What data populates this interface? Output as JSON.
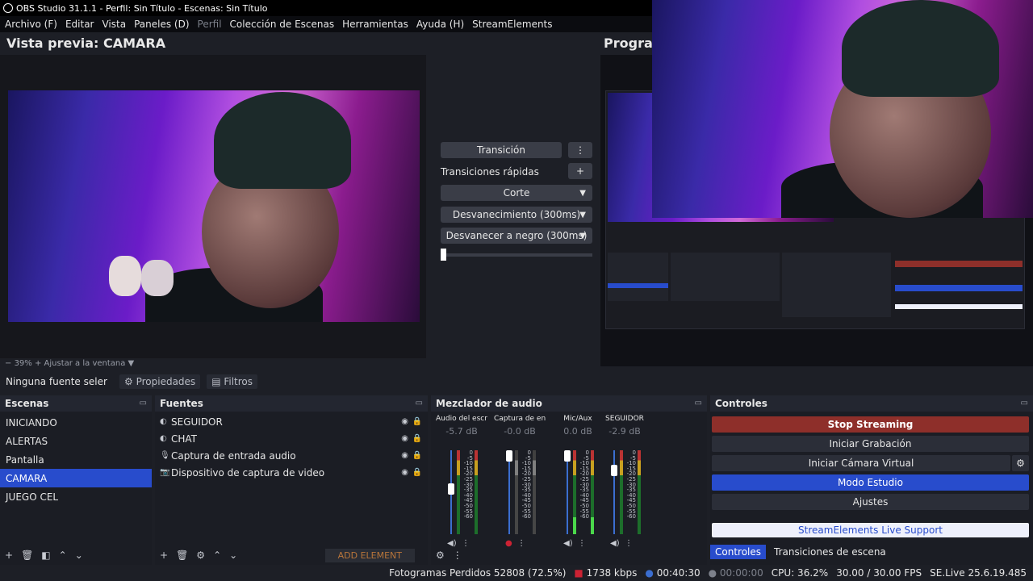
{
  "window": {
    "title": "OBS Studio 31.1.1 - Perfil: Sin Título - Escenas: Sin Título"
  },
  "menu": [
    {
      "label": "Archivo (F)",
      "enabled": true
    },
    {
      "label": "Editar",
      "enabled": true
    },
    {
      "label": "Vista",
      "enabled": true
    },
    {
      "label": "Paneles (D)",
      "enabled": true
    },
    {
      "label": "Perfil",
      "enabled": false
    },
    {
      "label": "Colección de Escenas",
      "enabled": true
    },
    {
      "label": "Herramientas",
      "enabled": true
    },
    {
      "label": "Ayuda (H)",
      "enabled": true
    },
    {
      "label": "StreamElements",
      "enabled": true
    }
  ],
  "preview": {
    "title": "Vista previa: CAMARA",
    "zoom": "39%",
    "fit_label": "Ajustar a la ventana"
  },
  "program": {
    "title": "Program"
  },
  "transition": {
    "button": "Transición",
    "quick_label": "Transiciones rápidas",
    "items": [
      "Corte",
      "Desvanecimiento (300ms)",
      "Desvanecer a negro (300ms)"
    ]
  },
  "source_toolbar": {
    "no_source": "Ninguna fuente seler",
    "properties": "Propiedades",
    "filters": "Filtros"
  },
  "scenes": {
    "title": "Escenas",
    "items": [
      "INICIANDO",
      "ALERTAS",
      "Pantalla",
      "CAMARA",
      "JUEGO CEL"
    ],
    "selected": "CAMARA"
  },
  "sources": {
    "title": "Fuentes",
    "items": [
      {
        "name": "SEGUIDOR",
        "icon": "browser-icon"
      },
      {
        "name": "CHAT",
        "icon": "browser-icon"
      },
      {
        "name": "Captura de entrada audio",
        "icon": "microphone-icon"
      },
      {
        "name": "Dispositivo de captura de video",
        "icon": "camera-icon"
      }
    ],
    "add_element": "ADD ELEMENT"
  },
  "mixer": {
    "title": "Mezclador de audio",
    "scale": [
      "0",
      "-5",
      "-10",
      "-15",
      "-20",
      "-25",
      "-30",
      "-35",
      "-40",
      "-45",
      "-50",
      "-55",
      "-60"
    ],
    "channels": [
      {
        "name": "Audio del escrito",
        "db": "-5.7 dB",
        "volume": 0.55,
        "level": 0.0,
        "muted": false
      },
      {
        "name": "Captura de entra",
        "db": "-0.0 dB",
        "volume": 1.0,
        "level": 0.0,
        "muted": true
      },
      {
        "name": "Mic/Aux",
        "db": "0.0 dB",
        "volume": 1.0,
        "level": 0.2,
        "muted": false
      },
      {
        "name": "SEGUIDOR",
        "db": "-2.9 dB",
        "volume": 0.8,
        "level": 0.0,
        "muted": false
      }
    ]
  },
  "controls": {
    "title": "Controles",
    "buttons": [
      "Stop Streaming",
      "Iniciar Grabación",
      "Iniciar Cámara Virtual",
      "Modo Estudio",
      "Ajustes"
    ],
    "support": "StreamElements Live Support",
    "colors": {
      "stop": "#8e2f2a",
      "studio": "#284ccc",
      "support": "#eef0fb"
    }
  },
  "tabs": [
    "Controles",
    "Transiciones de escena"
  ],
  "status": {
    "dropped": "Fotogramas Perdidos 52808 (72.5%)",
    "bitrate": "1738 kbps",
    "stream_time": "00:40:30",
    "rec_time": "00:00:00",
    "cpu": "CPU: 36.2%",
    "fps": "30.00 / 30.00 FPS",
    "version": "SE.Live 25.6.19.485"
  }
}
